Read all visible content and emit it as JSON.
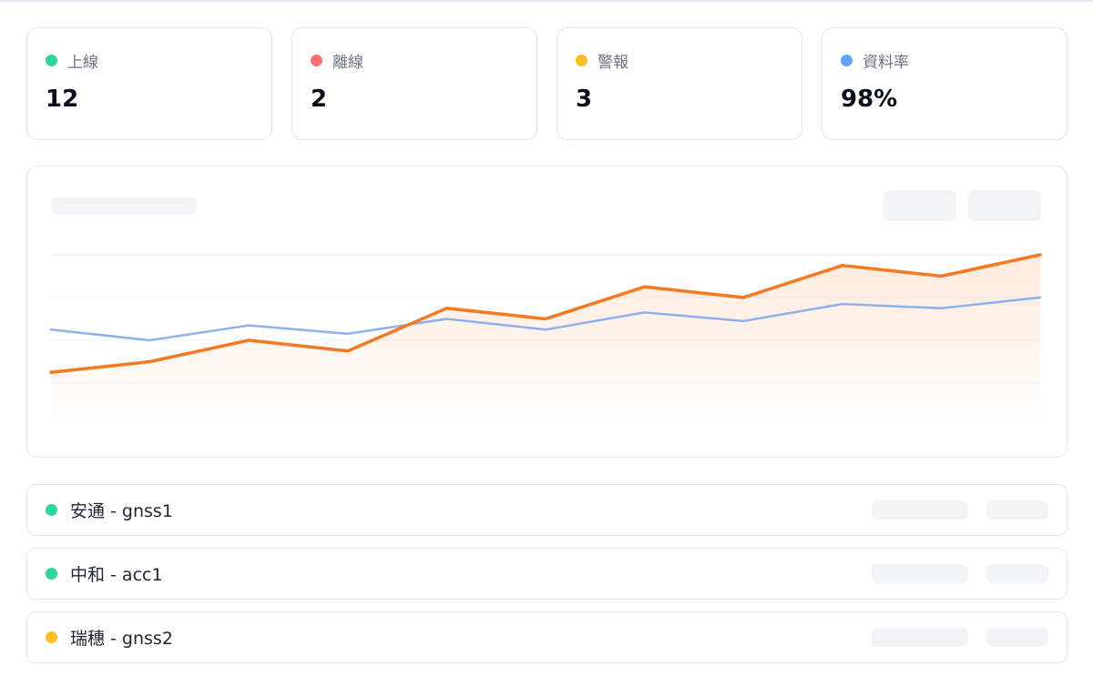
{
  "colors": {
    "online": "#34d399",
    "offline": "#f87171",
    "warning": "#fbbf24",
    "rate": "#60a5fa",
    "series_primary": "#f47920",
    "series_secondary": "#8fb0ec"
  },
  "stats": [
    {
      "label": "上線",
      "value": "12",
      "dot_color": "#34d399"
    },
    {
      "label": "離線",
      "value": "2",
      "dot_color": "#f87171"
    },
    {
      "label": "警報",
      "value": "3",
      "dot_color": "#fbbf24"
    },
    {
      "label": "資料率",
      "value": "98%",
      "dot_color": "#60a5fa"
    }
  ],
  "chart_data": {
    "type": "line",
    "x": [
      1,
      2,
      3,
      4,
      5,
      6,
      7,
      8,
      9,
      10,
      11
    ],
    "ylim": [
      0,
      100
    ],
    "grid": true,
    "series": [
      {
        "values": [
          25,
          30,
          40,
          35,
          55,
          50,
          65,
          60,
          75,
          70,
          80
        ],
        "color": "#f47920",
        "fill": true
      },
      {
        "values": [
          45,
          40,
          47,
          43,
          50,
          45,
          53,
          49,
          57,
          55,
          60
        ],
        "color": "#8fb0ec",
        "fill": false
      }
    ]
  },
  "stations": [
    {
      "label": "安通 - gnss1",
      "status": "online",
      "dot_color": "#34d399"
    },
    {
      "label": "中和 - acc1",
      "status": "online",
      "dot_color": "#34d399"
    },
    {
      "label": "瑞穗 - gnss2",
      "status": "warning",
      "dot_color": "#fbbf24"
    }
  ]
}
